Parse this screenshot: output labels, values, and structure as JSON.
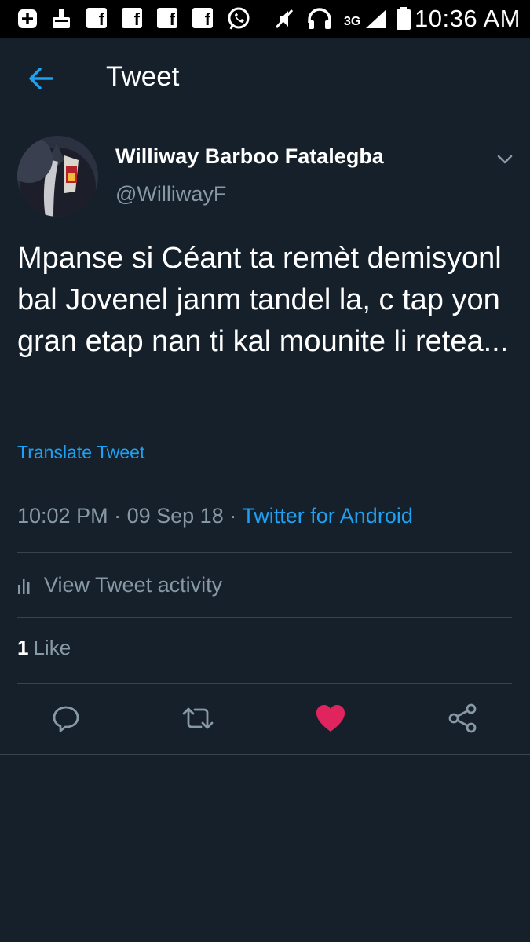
{
  "status_bar": {
    "time": "10:36 AM",
    "network": "3G",
    "icons": [
      "add-box-icon",
      "cleaner-icon",
      "facebook-icon",
      "facebook-icon",
      "facebook-icon",
      "facebook-icon",
      "whatsapp-icon",
      "muted-icon",
      "headset-icon",
      "signal-icon",
      "battery-icon"
    ],
    "fb_glyph": "f"
  },
  "app_bar": {
    "title": "Tweet",
    "back_icon": "arrow-left-icon"
  },
  "tweet": {
    "author_name": "Williway Barboo Fatalegba",
    "author_handle": "@WilliwayF",
    "text": "Mpanse si Céant ta remèt demisyonl bal Jovenel janm tandel la, c tap yon gran etap nan ti kal mounite li retea...",
    "translate_label": "Translate Tweet",
    "time": "10:02 PM",
    "date": "09 Sep 18",
    "separator": "·",
    "source": "Twitter for Android",
    "activity_label": "View Tweet activity",
    "like_count": "1",
    "like_label": "Like"
  },
  "actions": [
    "reply-icon",
    "retweet-icon",
    "like-icon",
    "share-icon"
  ],
  "colors": {
    "background": "#15202b",
    "status_bar": "#000000",
    "accent": "#1da1f2",
    "muted": "#8899a6",
    "divider": "#38444d",
    "like": "#e0245e"
  }
}
